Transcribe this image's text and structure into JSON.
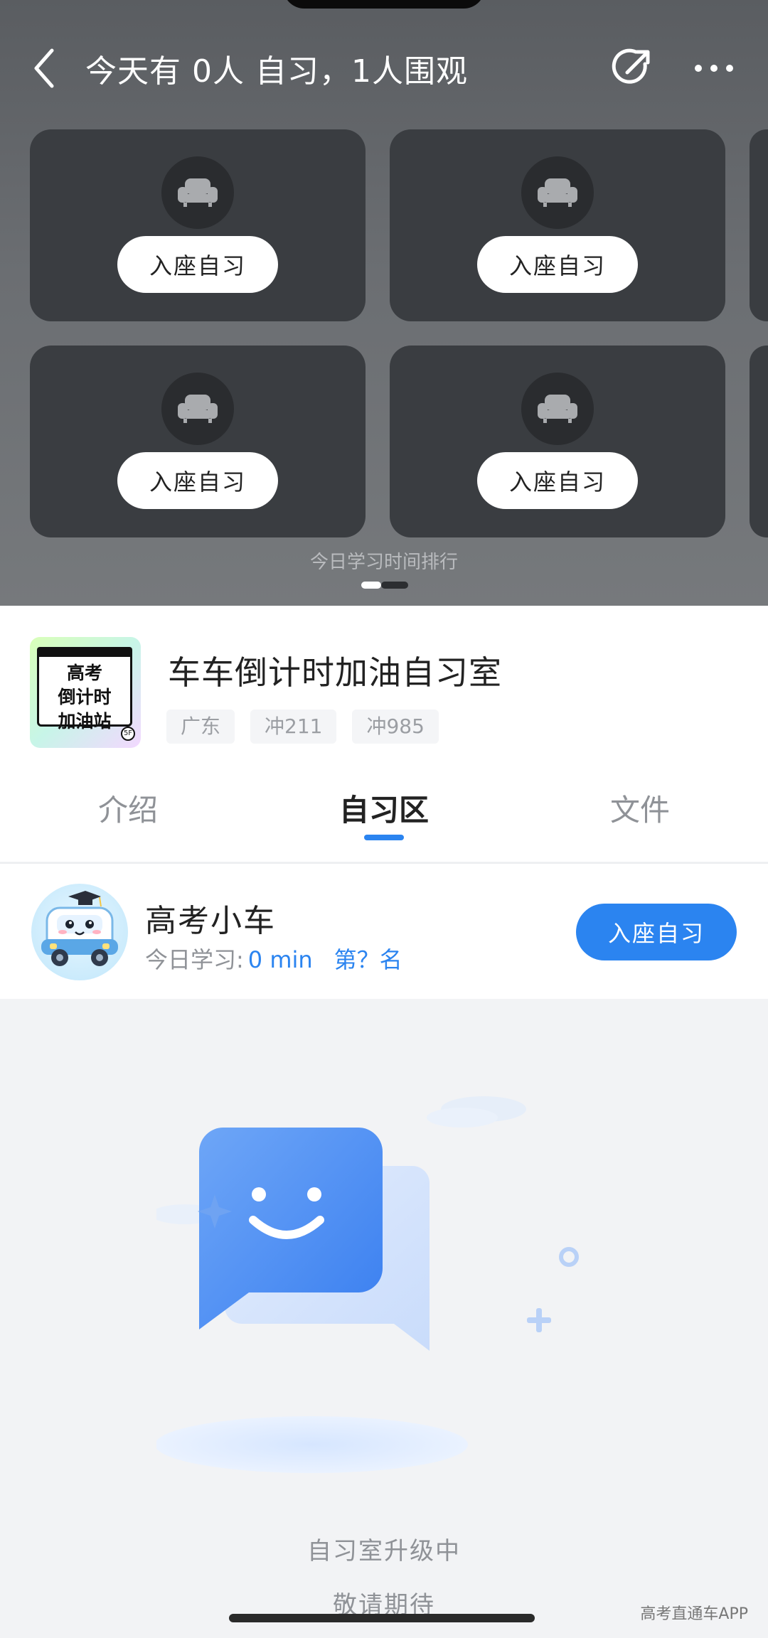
{
  "header": {
    "title": "今天有 0人 自习，1人围观"
  },
  "seats": [
    {
      "button_label": "入座自习"
    },
    {
      "button_label": "入座自习"
    },
    {
      "button_label": "入座自习"
    },
    {
      "button_label": "入座自习"
    }
  ],
  "rank_label": "今日学习时间排行",
  "room": {
    "avatar_text": [
      "高考",
      "倒计时",
      "加油站"
    ],
    "avatar_badge": "5F",
    "name": "车车倒计时加油自习室",
    "tags": [
      "广东",
      "冲211",
      "冲985"
    ]
  },
  "tabs": [
    {
      "label": "介绍",
      "active": false
    },
    {
      "label": "自习区",
      "active": true
    },
    {
      "label": "文件",
      "active": false
    }
  ],
  "user": {
    "name": "高考小车",
    "study_label": "今日学习:",
    "study_value": "0 min",
    "rank": "第？名",
    "join_label": "入座自习"
  },
  "empty_state": {
    "title": "自习室升级中",
    "subtitle": "敬请期待"
  },
  "watermark": "高考直通车APP",
  "colors": {
    "accent": "#2b84f0",
    "top_bg": "#6b6e72",
    "card_bg": "#3a3d41"
  }
}
